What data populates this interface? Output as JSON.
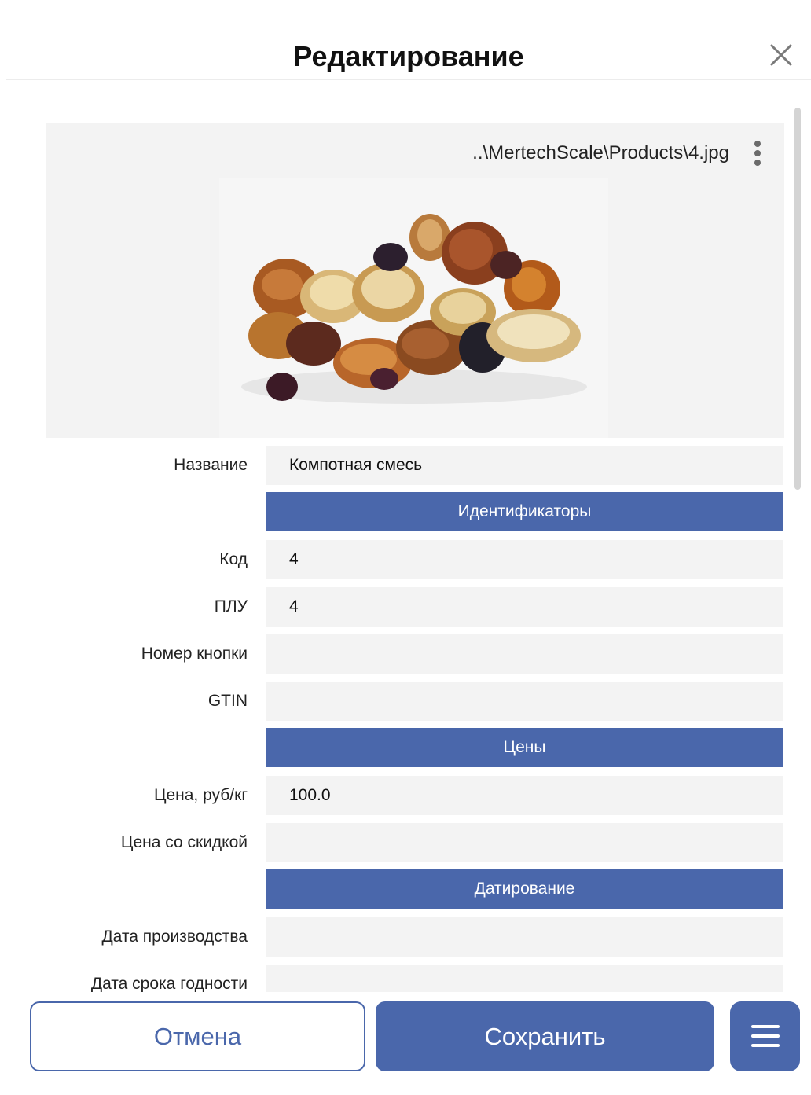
{
  "dialog": {
    "title": "Редактирование"
  },
  "image": {
    "path": "..\\MertechScale\\Products\\4.jpg",
    "alt": "Компотная смесь"
  },
  "fields": {
    "name": {
      "label": "Название",
      "value": "Компотная смесь"
    },
    "code": {
      "label": "Код",
      "value": "4"
    },
    "plu": {
      "label": "ПЛУ",
      "value": "4"
    },
    "button_number": {
      "label": "Номер кнопки",
      "value": ""
    },
    "gtin": {
      "label": "GTIN",
      "value": ""
    },
    "price": {
      "label": "Цена, руб/кг",
      "value": "100.0"
    },
    "discount_price": {
      "label": "Цена со скидкой",
      "value": ""
    },
    "production_date": {
      "label": "Дата производства",
      "value": ""
    },
    "expiry_date": {
      "label": "Дата срока годности",
      "value": ""
    }
  },
  "sections": {
    "identifiers": "Идентификаторы",
    "prices": "Цены",
    "dating": "Датирование"
  },
  "footer": {
    "cancel_label": "Отмена",
    "save_label": "Сохранить",
    "menu_icon": "hamburger-icon"
  },
  "colors": {
    "accent": "#4a67ab",
    "field_bg": "#f3f3f3"
  }
}
